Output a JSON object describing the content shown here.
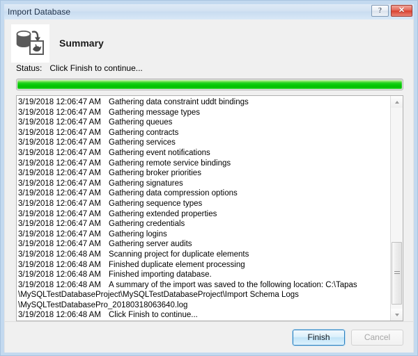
{
  "window": {
    "title": "Import Database",
    "help_button": "?",
    "close_button": "✕"
  },
  "header": {
    "icon": "database-import-icon",
    "title": "Summary"
  },
  "status": {
    "label": "Status:",
    "value": "Click Finish to continue..."
  },
  "progress": {
    "percent": 100,
    "color": "#06c906"
  },
  "log": {
    "entries": [
      {
        "time": "3/19/2018 12:06:47 AM",
        "message": "Gathering data constraint uddt bindings"
      },
      {
        "time": "3/19/2018 12:06:47 AM",
        "message": "Gathering message types"
      },
      {
        "time": "3/19/2018 12:06:47 AM",
        "message": "Gathering queues"
      },
      {
        "time": "3/19/2018 12:06:47 AM",
        "message": "Gathering contracts"
      },
      {
        "time": "3/19/2018 12:06:47 AM",
        "message": "Gathering services"
      },
      {
        "time": "3/19/2018 12:06:47 AM",
        "message": "Gathering event notifications"
      },
      {
        "time": "3/19/2018 12:06:47 AM",
        "message": "Gathering remote service bindings"
      },
      {
        "time": "3/19/2018 12:06:47 AM",
        "message": "Gathering broker priorities"
      },
      {
        "time": "3/19/2018 12:06:47 AM",
        "message": "Gathering signatures"
      },
      {
        "time": "3/19/2018 12:06:47 AM",
        "message": "Gathering data compression options"
      },
      {
        "time": "3/19/2018 12:06:47 AM",
        "message": "Gathering sequence types"
      },
      {
        "time": "3/19/2018 12:06:47 AM",
        "message": "Gathering extended properties"
      },
      {
        "time": "3/19/2018 12:06:47 AM",
        "message": "Gathering credentials"
      },
      {
        "time": "3/19/2018 12:06:47 AM",
        "message": "Gathering logins"
      },
      {
        "time": "3/19/2018 12:06:47 AM",
        "message": "Gathering server audits"
      },
      {
        "time": "3/19/2018 12:06:48 AM",
        "message": "Scanning project for duplicate elements"
      },
      {
        "time": "3/19/2018 12:06:48 AM",
        "message": "Finished duplicate element processing"
      },
      {
        "time": "3/19/2018 12:06:48 AM",
        "message": "Finished importing database."
      },
      {
        "time": "3/19/2018 12:06:48 AM",
        "message": "A summary of the import was saved to the following location: C:\\Tapas"
      },
      {
        "time": "",
        "message": "\\MySQLTestDatabaseProject\\MySQLTestDatabaseProject\\Import Schema Logs"
      },
      {
        "time": "",
        "message": "\\MySQLTestDatabasePro_20180318063640.log"
      },
      {
        "time": "3/19/2018 12:06:48 AM",
        "message": "Click Finish to continue..."
      }
    ]
  },
  "buttons": {
    "finish": "Finish",
    "cancel": "Cancel"
  },
  "scrollbar": {
    "up_arrow": "scroll-up-arrow",
    "down_arrow": "scroll-down-arrow"
  }
}
